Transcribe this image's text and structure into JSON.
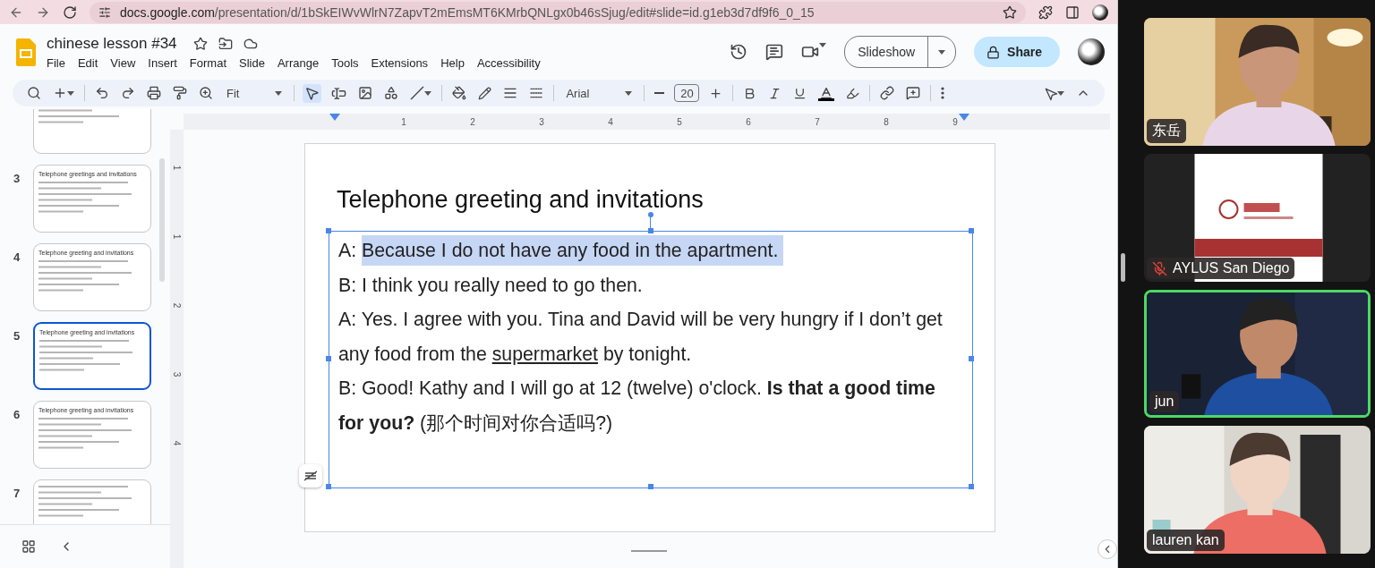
{
  "browser": {
    "url_host": "docs.google.com",
    "url_path": "/presentation/d/1bSkEIWvWlrN7ZapvT2mEmsMT6KMrbQNLgx0b46sSjug/edit#slide=id.g1eb3d7df9f6_0_15"
  },
  "document": {
    "title": "chinese lesson #34",
    "menu": [
      "File",
      "Edit",
      "View",
      "Insert",
      "Format",
      "Slide",
      "Arrange",
      "Tools",
      "Extensions",
      "Help",
      "Accessibility"
    ],
    "slideshow_button": "Slideshow",
    "share_button": "Share"
  },
  "toolbar": {
    "zoom": "Fit",
    "font": "Arial",
    "font_size": "20",
    "select_tool_selected": true
  },
  "rulers": {
    "horizontal": [
      "1",
      "2",
      "3",
      "4",
      "5",
      "6",
      "7",
      "8",
      "9"
    ],
    "vertical": [
      "1",
      "1",
      "2",
      "3",
      "4"
    ]
  },
  "filmstrip": [
    {
      "selected": false
    },
    {
      "number": "3",
      "title": "Telephone greetings and invitations",
      "selected": false
    },
    {
      "number": "4",
      "title": "Telephone greeting and invitations",
      "selected": false
    },
    {
      "number": "5",
      "title": "Telephone greeting and invitations",
      "selected": true
    },
    {
      "number": "6",
      "title": "Telephone greeting and invitations",
      "selected": false
    },
    {
      "number": "7",
      "selected": false
    }
  ],
  "slide": {
    "title": "Telephone greeting and invitations",
    "paragraphs": [
      {
        "runs": [
          {
            "text": "A: "
          },
          {
            "text": "Because I do not have any food in the apartment.",
            "highlighted": true
          }
        ]
      },
      {
        "runs": [
          {
            "text": "B: I think you really need to go then."
          }
        ]
      },
      {
        "runs": [
          {
            "text": "A: Yes. I agree with you. Tina and David will be very hungry if I don’t get any food from the "
          },
          {
            "text": "supermarket",
            "underline": true
          },
          {
            "text": " by tonight."
          }
        ]
      },
      {
        "runs": [
          {
            "text": "B: Good! Kathy and I will go at 12 (twelve) o'clock. "
          },
          {
            "text": "Is that a good time for you?",
            "bold": true
          },
          {
            "text": " (那个时间对你合适吗?)"
          }
        ]
      }
    ]
  },
  "participants": [
    {
      "name": "东岳",
      "muted": false,
      "speaking": false
    },
    {
      "name": "AYLUS San Diego",
      "muted": true,
      "speaking": false
    },
    {
      "name": "jun",
      "muted": false,
      "speaking": true
    },
    {
      "name": "lauren kan",
      "muted": false,
      "speaking": false
    }
  ]
}
